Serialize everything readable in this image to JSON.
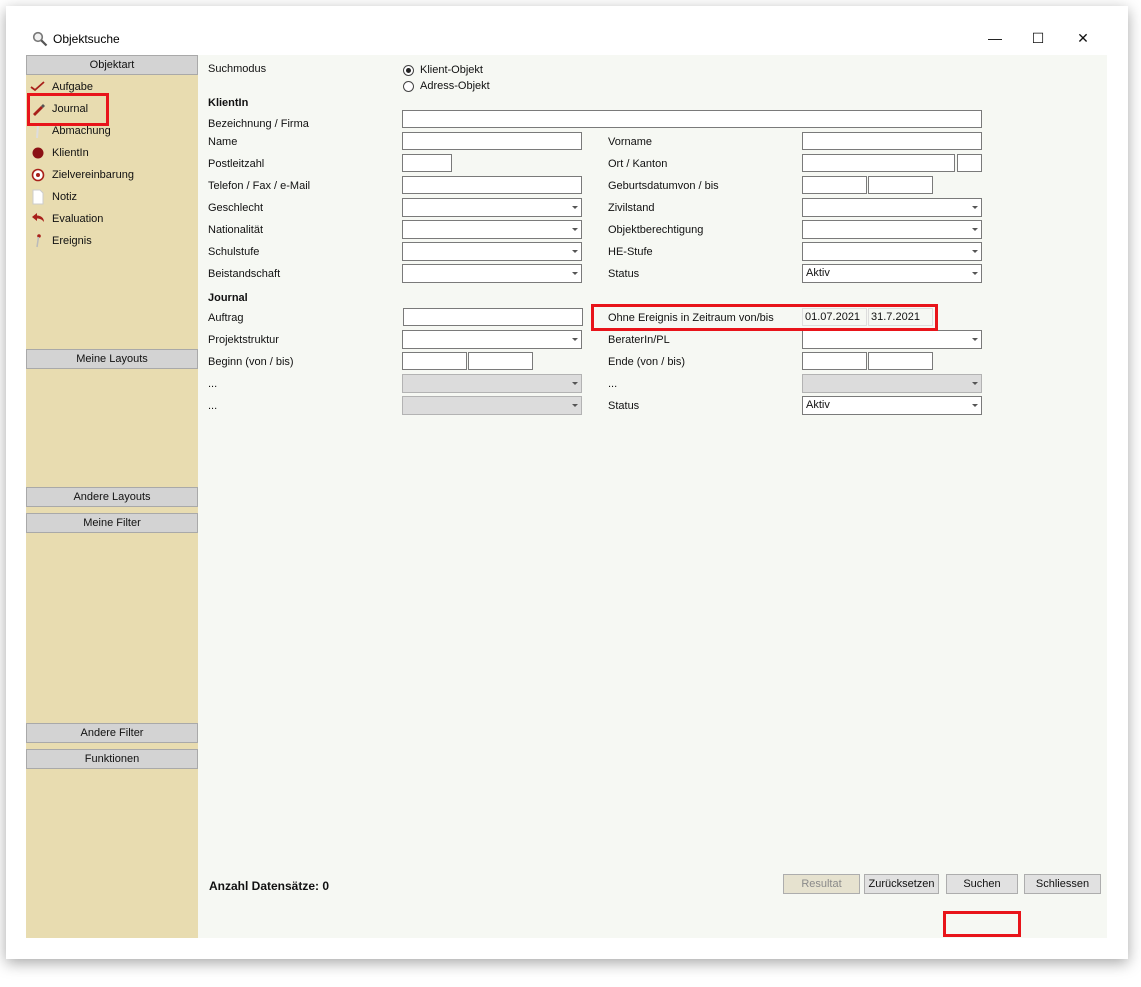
{
  "window": {
    "title": "Objektsuche",
    "minimize_glyph": "—",
    "maximize_glyph": "☐",
    "close_glyph": "✕"
  },
  "sidebar": {
    "header": "Objektart",
    "items": [
      {
        "label": "Aufgabe",
        "icon": "checkmark-icon"
      },
      {
        "label": "Journal",
        "icon": "pencil-icon"
      },
      {
        "label": "Abmachung",
        "icon": "pin-icon"
      },
      {
        "label": "KlientIn",
        "icon": "person-icon"
      },
      {
        "label": "Zielvereinbarung",
        "icon": "target-icon"
      },
      {
        "label": "Notiz",
        "icon": "note-icon"
      },
      {
        "label": "Evaluation",
        "icon": "undo-arrow-icon"
      },
      {
        "label": "Ereignis",
        "icon": "pin-icon"
      }
    ],
    "sections": [
      "Meine Layouts",
      "Andere Layouts",
      "Meine Filter",
      "Andere Filter",
      "Funktionen"
    ]
  },
  "form": {
    "suchmodus_label": "Suchmodus",
    "radio_klient": "Klient-Objekt",
    "radio_adress": "Adress-Objekt",
    "section_klient": "KlientIn",
    "bezeichnung": "Bezeichnung / Firma",
    "name": "Name",
    "vorname": "Vorname",
    "plz": "Postleitzahl",
    "ort": "Ort / Kanton",
    "telefon": "Telefon / Fax / e-Mail",
    "geburtsdatum": "Geburtsdatumvon / bis",
    "geschlecht": "Geschlecht",
    "zivilstand": "Zivilstand",
    "nationalitaet": "Nationalität",
    "objektberechtigung": "Objektberechtigung",
    "schulstufe": "Schulstufe",
    "he_stufe": "HE-Stufe",
    "beistandschaft": "Beistandschaft",
    "status": "Status",
    "status_value": "Aktiv",
    "section_journal": "Journal",
    "auftrag": "Auftrag",
    "ohne_ereignis": "Ohne Ereignis in Zeitraum von/bis",
    "ohne_ereignis_von": "01.07.2021",
    "ohne_ereignis_bis": "31.7.2021",
    "projektstruktur": "Projektstruktur",
    "berater": "BeraterIn/PL",
    "beginn": "Beginn (von / bis)",
    "ende": "Ende (von / bis)",
    "ellipsis": "...",
    "status2": "Status",
    "status2_value": "Aktiv"
  },
  "footer": {
    "count_label": "Anzahl Datensätze: 0",
    "btn_resultat": "Resultat",
    "btn_reset": "Zurücksetzen",
    "btn_suchen": "Suchen",
    "btn_schliessen": "Schliessen"
  },
  "colors": {
    "highlight": "#e8141a",
    "sidebar": "#e8dcb0",
    "main": "#f6f8f3"
  }
}
